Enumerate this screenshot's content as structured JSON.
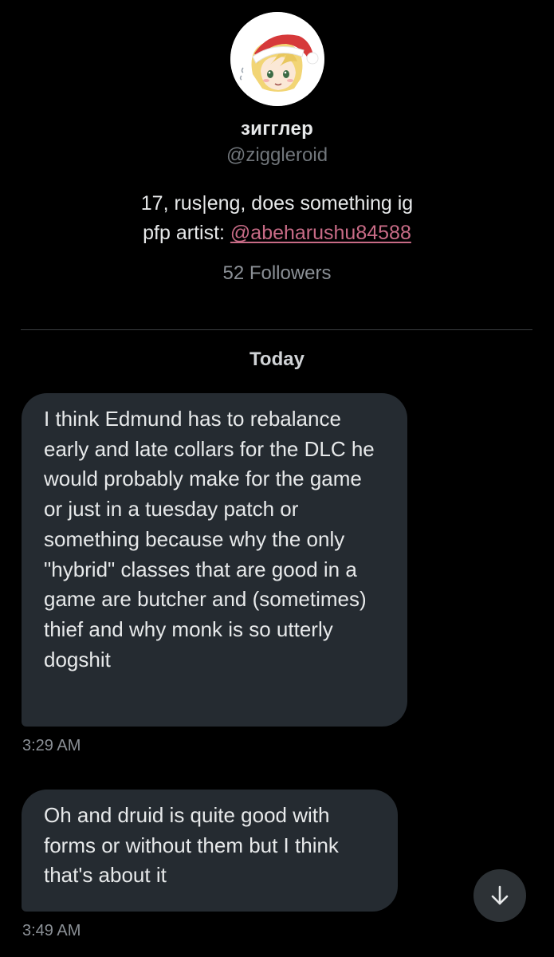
{
  "profile": {
    "avatar_icon": "anime-avatar-santa-hat",
    "display_name": "зигглер",
    "handle": "@ziggleroid",
    "bio_line1": "17, rus|eng, does something ig",
    "bio_line2_prefix": "pfp artist: ",
    "bio_mention": "@abeharushu84588",
    "followers": "52 Followers"
  },
  "conversation": {
    "date_separator": "Today",
    "messages": [
      {
        "text": "I think Edmund has to rebalance early and late collars for the DLC he would probably make for the game or just in a tuesday patch or something because why the only \"hybrid\" classes that are good in a game are butcher and (sometimes) thief and why monk is so utterly dogshit",
        "time": "3:29 AM"
      },
      {
        "text": "Oh and druid is quite good with forms or without them but I think that's about it",
        "time": "3:49 AM"
      }
    ]
  },
  "controls": {
    "scroll_down_icon": "arrow-down-icon"
  },
  "colors": {
    "background": "#000000",
    "bubble": "#252b31",
    "mention": "#c86b86",
    "secondary_text": "#71767b"
  }
}
